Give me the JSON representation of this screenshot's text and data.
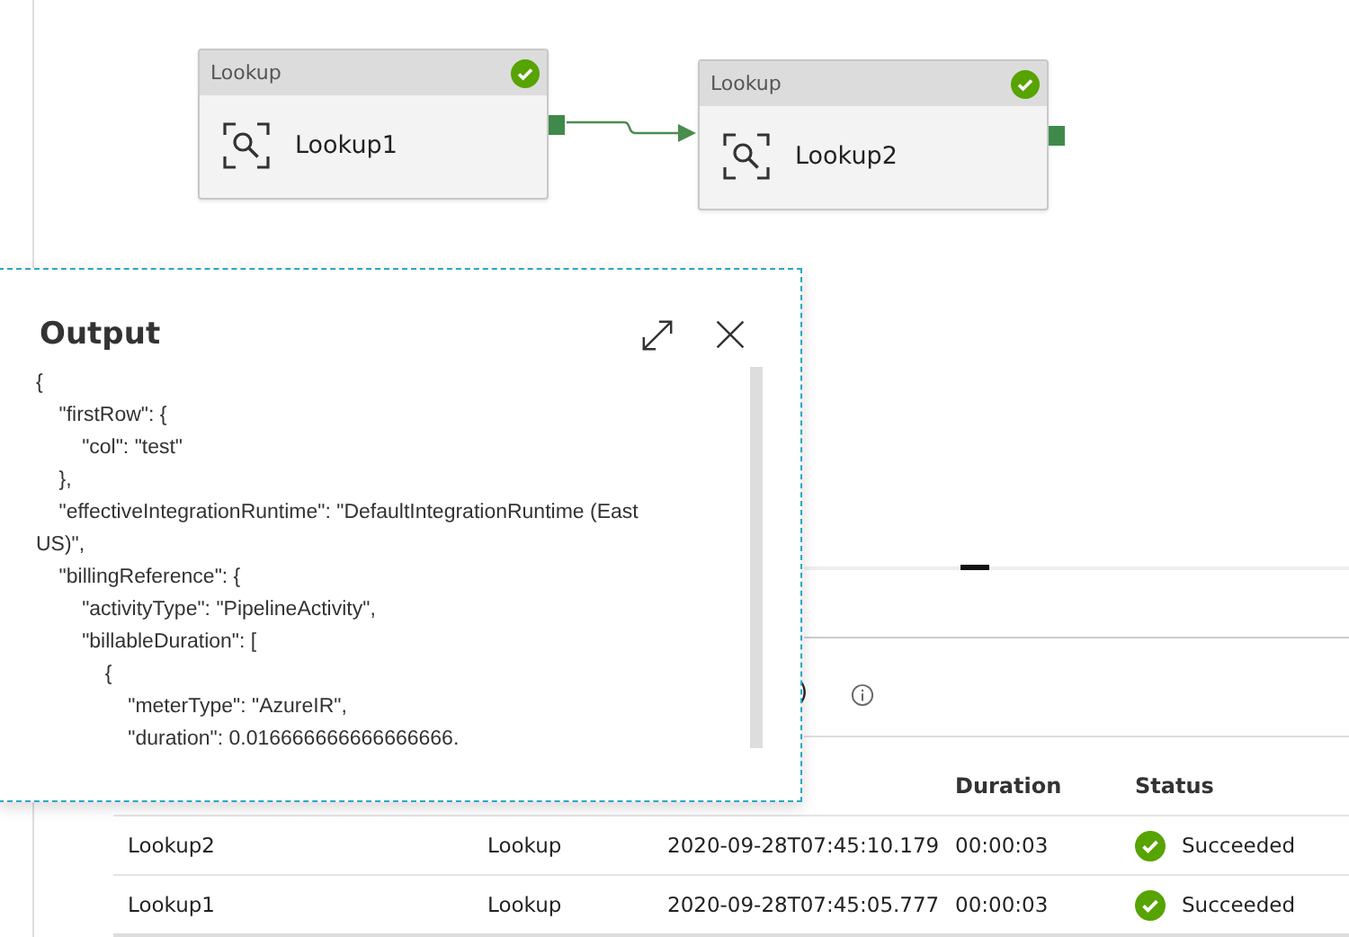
{
  "pipeline": {
    "nodes": [
      {
        "type": "Lookup",
        "name": "Lookup1",
        "succeeded": true
      },
      {
        "type": "Lookup",
        "name": "Lookup2",
        "succeeded": true
      }
    ]
  },
  "tail_text": ")",
  "table": {
    "columns": [
      "Duration",
      "Status"
    ],
    "rows": [
      {
        "name": "Lookup2",
        "type": "Lookup",
        "start": "2020-09-28T07:45:10.179",
        "duration": "00:00:03",
        "status": "Succeeded",
        "succeeded": true
      },
      {
        "name": "Lookup1",
        "type": "Lookup",
        "start": "2020-09-28T07:45:05.777",
        "duration": "00:00:03",
        "status": "Succeeded",
        "succeeded": true
      }
    ]
  },
  "output": {
    "title": "Output",
    "text": "{\n    \"firstRow\": {\n        \"col\": \"test\"\n    },\n    \"effectiveIntegrationRuntime\": \"DefaultIntegrationRuntime (East\nUS)\",\n    \"billingReference\": {\n        \"activityType\": \"PipelineActivity\",\n        \"billableDuration\": [\n            {\n                \"meterType\": \"AzureIR\",\n                \"duration\": 0.016666666666666666."
  }
}
